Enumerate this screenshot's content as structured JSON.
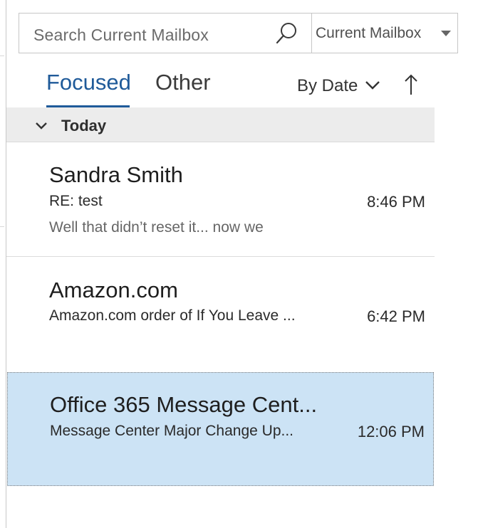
{
  "search": {
    "placeholder": "Search Current Mailbox",
    "scope": "Current Mailbox",
    "icon": "search-icon"
  },
  "tabs": [
    {
      "label": "Focused",
      "selected": true
    },
    {
      "label": "Other",
      "selected": false
    }
  ],
  "sort": {
    "label": "By Date",
    "direction_icon": "arrow-up-icon"
  },
  "group": {
    "label": "Today",
    "expanded": true
  },
  "messages": [
    {
      "sender": "Sandra Smith",
      "subject": "RE: test",
      "time": "8:46 PM",
      "preview": "Well that didn’t reset it... now we",
      "selected": false
    },
    {
      "sender": "Amazon.com",
      "subject": "Amazon.com order of If You Leave ...",
      "time": "6:42 PM",
      "preview": "",
      "selected": false
    },
    {
      "sender": "Office 365 Message Cent...",
      "subject": "Message Center Major Change Up...",
      "time": "12:06 PM",
      "preview": "",
      "selected": true
    }
  ],
  "colors": {
    "accent": "#1f5a99",
    "selected_background": "#cce3f5",
    "group_header_background": "#ececec"
  }
}
